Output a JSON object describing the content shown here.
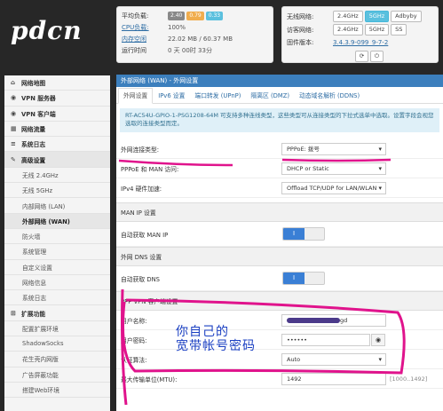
{
  "brand": {
    "logo": "pdcn"
  },
  "status": {
    "cpu_load_label": "平均负载:",
    "loads": [
      "2.40",
      "0.79",
      "0.33"
    ],
    "load_colors": [
      "#888888",
      "#f0ad4e",
      "#5bc0de"
    ],
    "cpu_usage_label": "CPU负载:",
    "cpu_usage": "100%",
    "memory_label": "内存空闲",
    "memory": "22.02 MB / 60.37 MB",
    "uptime_label": "运行时间",
    "uptime": "0 天 00时 33分"
  },
  "quick": {
    "wireless_label": "无线网络:",
    "wireless_btns": [
      "2.4GHz",
      "5GHz",
      "Adbyby"
    ],
    "guest_label": "访客网络:",
    "guest_btns": [
      "2.4GHz",
      "5GHz",
      "SS"
    ],
    "firmware_label": "固件版本:",
    "firmware": "3.4.3.9-099_9-7-2"
  },
  "sidebar": {
    "items": [
      {
        "label": "网络地图",
        "icon": "home-icon",
        "level": "top"
      },
      {
        "label": "VPN 服务器",
        "icon": "globe-icon",
        "level": "top"
      },
      {
        "label": "VPN 客户端",
        "icon": "globe-icon",
        "level": "top"
      },
      {
        "label": "网络流量",
        "icon": "chart-icon",
        "level": "top"
      },
      {
        "label": "系统日志",
        "icon": "list-icon",
        "level": "top"
      },
      {
        "label": "高级设置",
        "icon": "wrench-icon",
        "level": "top",
        "active": true
      },
      {
        "label": "无线 2.4GHz",
        "level": "sub"
      },
      {
        "label": "无线 5GHz",
        "level": "sub"
      },
      {
        "label": "内部网络 (LAN)",
        "level": "sub"
      },
      {
        "label": "外部网络 (WAN)",
        "level": "sub",
        "active": true
      },
      {
        "label": "防火墙",
        "level": "sub"
      },
      {
        "label": "系统管理",
        "level": "sub"
      },
      {
        "label": "自定义设置",
        "level": "sub"
      },
      {
        "label": "网络信息",
        "level": "sub"
      },
      {
        "label": "系统日志",
        "level": "sub"
      },
      {
        "label": "扩展功能",
        "icon": "plus-icon",
        "level": "top"
      },
      {
        "label": "配置扩展环境",
        "level": "sub"
      },
      {
        "label": "ShadowSocks",
        "level": "sub"
      },
      {
        "label": "花生壳内网版",
        "level": "sub"
      },
      {
        "label": "广告屏蔽功能",
        "level": "sub"
      },
      {
        "label": "搭建Web环境",
        "level": "sub"
      }
    ]
  },
  "main": {
    "header": "外部网络 (WAN) - 外网设置",
    "tabs": [
      "外网设置",
      "IPv6 设置",
      "端口转发 (UPnP)",
      "隔离区 (DMZ)",
      "动态域名解析 (DDNS)"
    ],
    "info": "RT-AC54U-GPIO-1-PSG1208-64M 可支持多种连线类型，这些类型可从连接类型的下拉式选单中选取。设置字段会视您选取的连接类型而定。",
    "wan_type_label": "外网连接类型:",
    "wan_type": "PPPoE: 拨号",
    "pppoe_man_label": "PPPoE 和 MAN 访问:",
    "pppoe_man": "DHCP or Static",
    "hw_accel_label": "IPv4 硬件加速:",
    "hw_accel": "Offload TCP/UDP for LAN/WLAN",
    "man_ip_section": "MAN IP 设置",
    "man_ip_auto_label": "自动获取 MAN IP",
    "dns_section": "外网 DNS 设置",
    "dns_auto_label": "自动获取 DNS",
    "vpn_section": "PPP VPN 客户端设置",
    "user_label": "用户名称:",
    "user_value": "gd",
    "pass_label": "用户密码:",
    "pass_value": "••••••",
    "auth_label": "认证算法:",
    "auth_value": "Auto",
    "mtu_label": "最大传输单位(MTU):",
    "mtu_value": "1492",
    "mtu_hint": "[1000..1492]",
    "toggle_on": "I"
  },
  "annotation": {
    "line1": "你自己的",
    "line2": "宽带帐号密码"
  },
  "colors": {
    "accent": "#3c7fbd",
    "annotation": "#e0138c"
  }
}
